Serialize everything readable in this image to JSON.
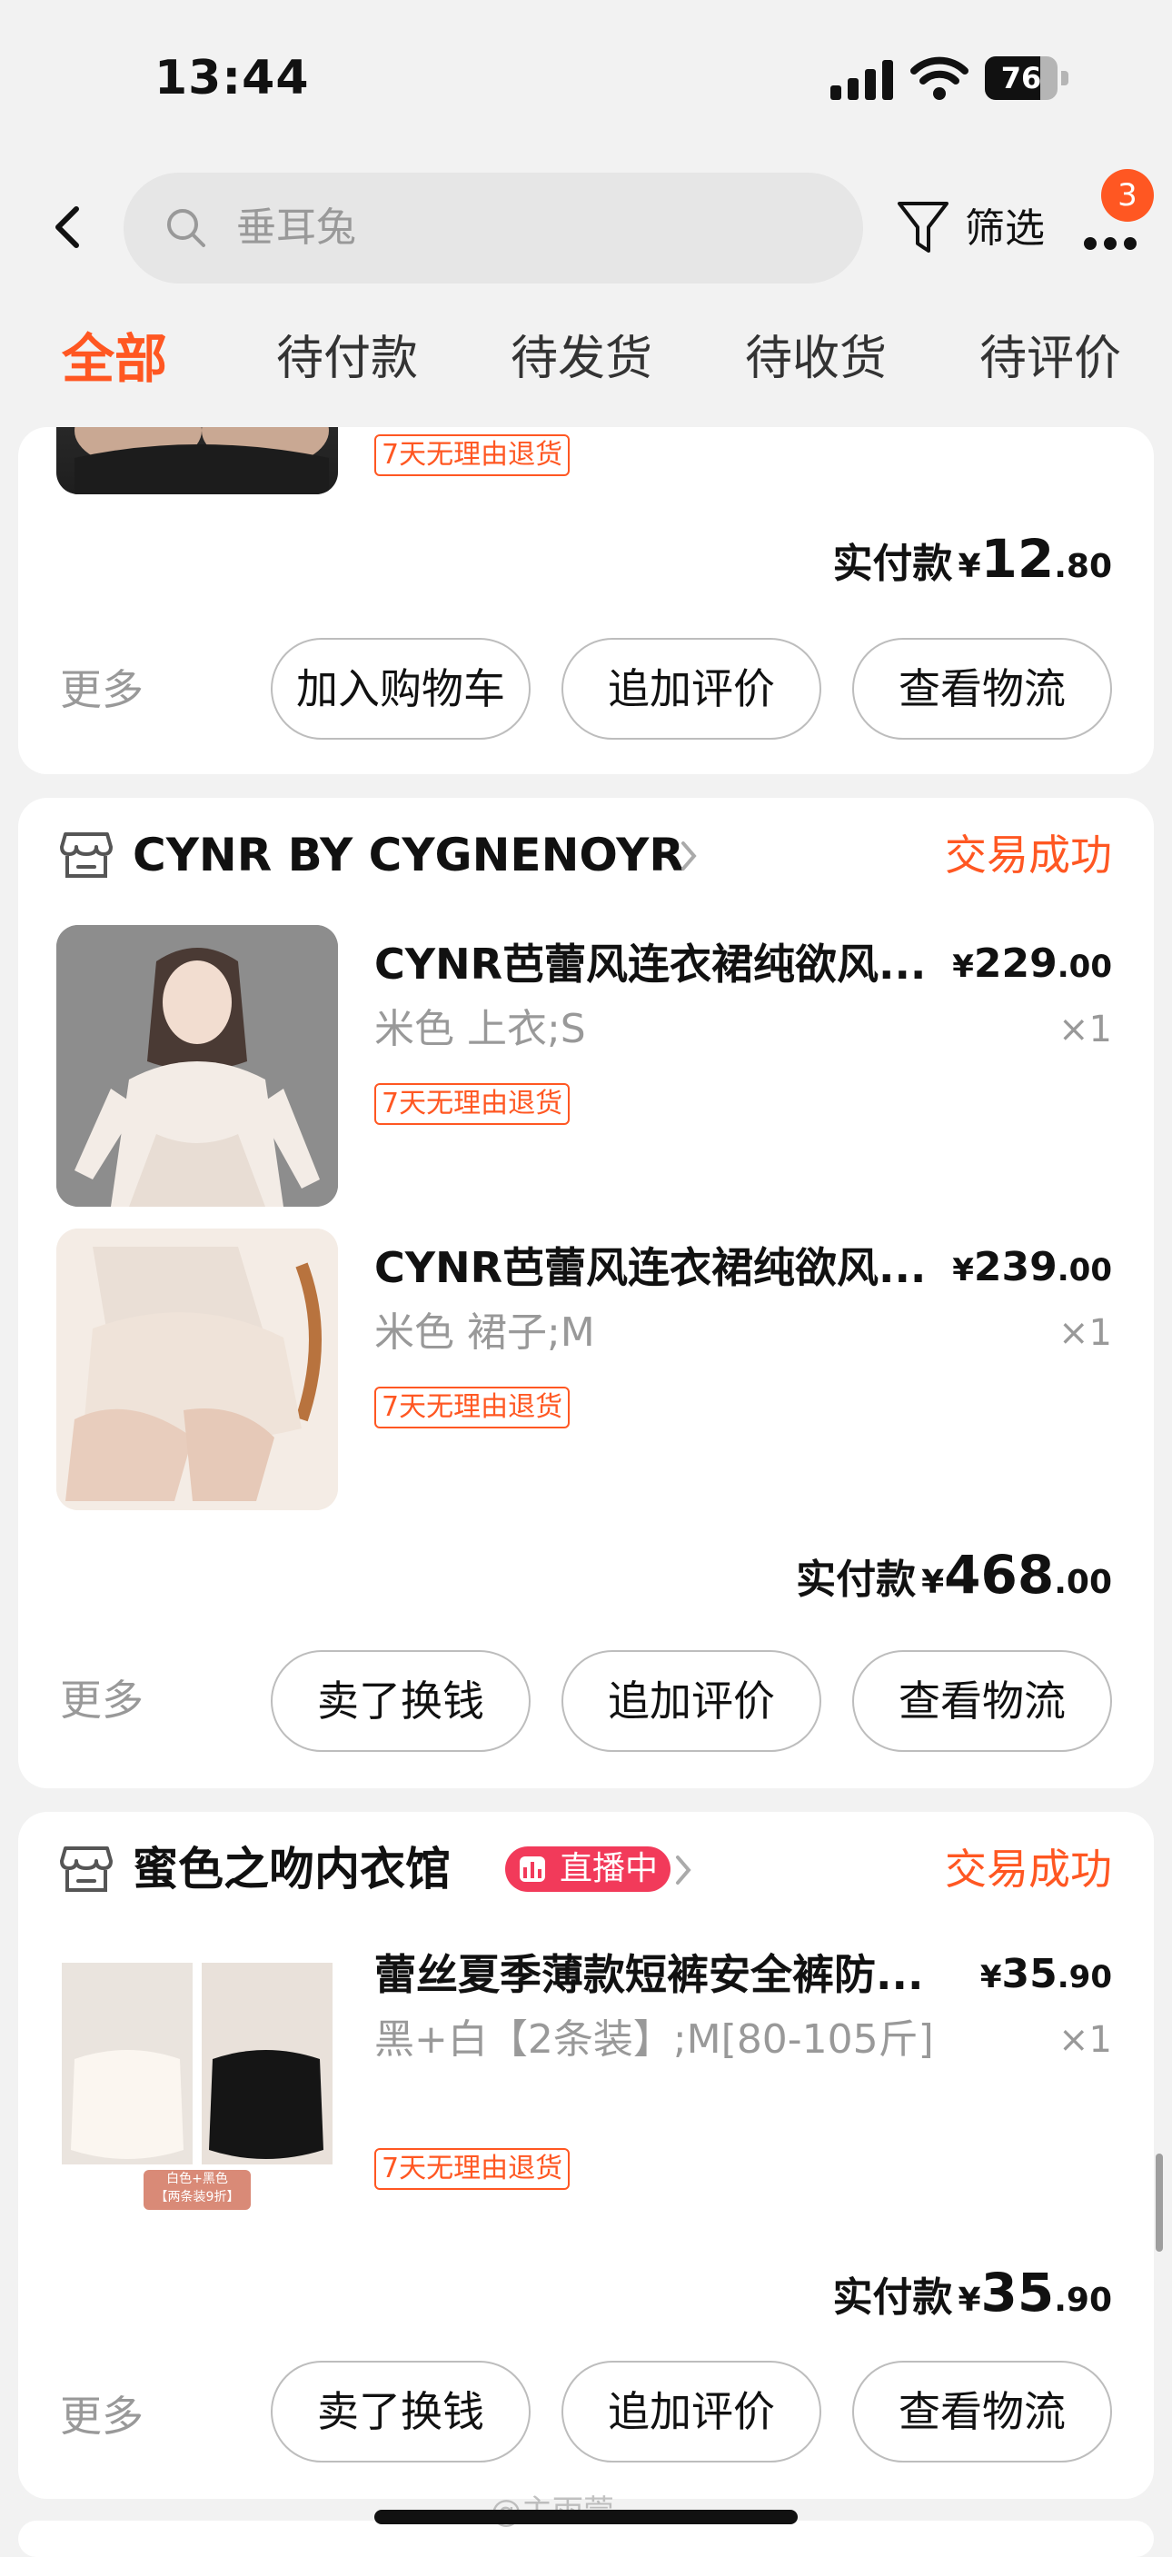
{
  "status_bar": {
    "time": "13:44",
    "battery": "76",
    "battery_level": 0.76
  },
  "header": {
    "search_placeholder": "垂耳兔",
    "filter_label": "筛选",
    "more_badge": "3"
  },
  "tabs": [
    {
      "label": "全部",
      "active": true
    },
    {
      "label": "待付款"
    },
    {
      "label": "待发货"
    },
    {
      "label": "待收货"
    },
    {
      "label": "待评价"
    }
  ],
  "orders": [
    {
      "items": [
        {
          "return_tag": "7天无理由退货"
        }
      ],
      "paid_label": "实付款",
      "currency": "¥",
      "paid_int": "12",
      "paid_dec": ".80",
      "more": "更多",
      "buttons": [
        "加入购物车",
        "追加评价",
        "查看物流"
      ]
    },
    {
      "shop": "CYNR BY CYGNENOYR",
      "status": "交易成功",
      "items": [
        {
          "title": "CYNR芭蕾风连衣裙纯欲风...",
          "price_int": "229",
          "price_dec": ".00",
          "sku": "米色 上衣;S",
          "qty": "×1",
          "return_tag": "7天无理由退货"
        },
        {
          "title": "CYNR芭蕾风连衣裙纯欲风...",
          "price_int": "239",
          "price_dec": ".00",
          "sku": "米色 裙子;M",
          "qty": "×1",
          "return_tag": "7天无理由退货"
        }
      ],
      "paid_label": "实付款",
      "currency": "¥",
      "paid_int": "468",
      "paid_dec": ".00",
      "more": "更多",
      "buttons": [
        "卖了换钱",
        "追加评价",
        "查看物流"
      ]
    },
    {
      "shop": "蜜色之吻内衣馆",
      "live": "直播中",
      "status": "交易成功",
      "items": [
        {
          "title": "蕾丝夏季薄款短裤安全裤防...",
          "price_int": "35",
          "price_dec": ".90",
          "sku": "黑+白【2条装】;M[80-105斤]",
          "qty": "×1",
          "return_tag": "7天无理由退货",
          "thumb_caption": "白色+黑色",
          "thumb_sub": "【两条装9折】"
        }
      ],
      "paid_label": "实付款",
      "currency": "¥",
      "paid_int": "35",
      "paid_dec": ".90",
      "more": "更多",
      "buttons": [
        "卖了换钱",
        "追加评价",
        "查看物流"
      ]
    }
  ],
  "watermark": "@主雨萱"
}
